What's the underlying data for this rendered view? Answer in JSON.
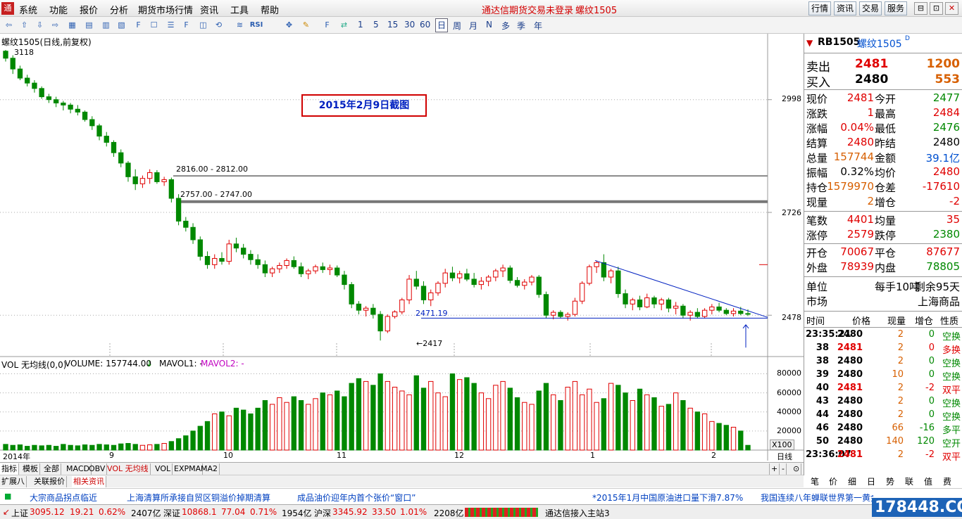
{
  "menu": {
    "logo": "通",
    "items": [
      "系统",
      "功能",
      "报价",
      "分析",
      "期货市场行情",
      "资讯",
      "工具",
      "帮助"
    ],
    "status": "通达信期货交易未登录",
    "symbol": "螺纹1505",
    "buttons": [
      "行情",
      "资讯",
      "交易",
      "服务"
    ],
    "win": [
      "⊟",
      "⊡",
      "✕"
    ]
  },
  "toolbar": {
    "periods": [
      "1",
      "5",
      "15",
      "30",
      "60",
      "日",
      "周",
      "月",
      "年",
      "多",
      "季",
      "年"
    ]
  },
  "chart": {
    "title": "螺纹1505(日线,前复权)",
    "high_label": "3118",
    "low_label": "←2417",
    "annotation": "2015年2月9日截图",
    "zone1": "2816.00 - 2812.00",
    "zone2": "2757.00 - 2747.00",
    "support_label": "2471.19",
    "price_axis": [
      "2998",
      "2726",
      "2478"
    ],
    "vol_axis": [
      "80000",
      "60000",
      "40000",
      "20000",
      "X100"
    ],
    "dates": [
      "2014年",
      "9",
      "10",
      "11",
      "12",
      "1",
      "2"
    ],
    "vol_caption": {
      "a": "VOL 无均线(0,0)",
      "b": "VOLUME: 157744.00",
      "c": "MAVOL1: -",
      "d": "MAVOL2: -",
      "arrow": "↓"
    },
    "daily_tab": "日线"
  },
  "chart_data": {
    "type": "candlestick",
    "title": "螺纹1505(日线,前复权)",
    "ylim": [
      2380,
      3140
    ],
    "note": "daily bars Aug 2014 – Feb 2015",
    "ohlc": [
      [
        3115,
        3118,
        3090,
        3098
      ],
      [
        3098,
        3105,
        3060,
        3072
      ],
      [
        3072,
        3080,
        3045,
        3050
      ],
      [
        3050,
        3058,
        3030,
        3038
      ],
      [
        3038,
        3045,
        3015,
        3025
      ],
      [
        3025,
        3030,
        3000,
        3005
      ],
      [
        3005,
        3012,
        2990,
        2998
      ],
      [
        2998,
        3005,
        2980,
        2990
      ],
      [
        2990,
        2995,
        2972,
        2985
      ],
      [
        2985,
        2990,
        2965,
        2975
      ],
      [
        2975,
        2985,
        2960,
        2968
      ],
      [
        2968,
        2972,
        2945,
        2950
      ],
      [
        2950,
        2958,
        2925,
        2935
      ],
      [
        2935,
        2940,
        2900,
        2910
      ],
      [
        2910,
        2920,
        2885,
        2895
      ],
      [
        2895,
        2900,
        2860,
        2870
      ],
      [
        2870,
        2878,
        2835,
        2845
      ],
      [
        2845,
        2850,
        2800,
        2812
      ],
      [
        2812,
        2830,
        2780,
        2795
      ],
      [
        2795,
        2815,
        2785,
        2808
      ],
      [
        2808,
        2830,
        2795,
        2822
      ],
      [
        2822,
        2828,
        2795,
        2800
      ],
      [
        2800,
        2812,
        2790,
        2805
      ],
      [
        2805,
        2810,
        2750,
        2760
      ],
      [
        2760,
        2770,
        2695,
        2705
      ],
      [
        2705,
        2715,
        2680,
        2690
      ],
      [
        2690,
        2700,
        2650,
        2660
      ],
      [
        2660,
        2668,
        2610,
        2620
      ],
      [
        2620,
        2632,
        2590,
        2600
      ],
      [
        2600,
        2625,
        2590,
        2615
      ],
      [
        2615,
        2630,
        2600,
        2608
      ],
      [
        2608,
        2660,
        2600,
        2650
      ],
      [
        2650,
        2665,
        2630,
        2640
      ],
      [
        2640,
        2650,
        2615,
        2625
      ],
      [
        2625,
        2635,
        2600,
        2612
      ],
      [
        2612,
        2625,
        2590,
        2600
      ],
      [
        2600,
        2610,
        2570,
        2580
      ],
      [
        2580,
        2595,
        2570,
        2590
      ],
      [
        2590,
        2605,
        2580,
        2598
      ],
      [
        2598,
        2615,
        2590,
        2610
      ],
      [
        2610,
        2620,
        2590,
        2595
      ],
      [
        2595,
        2605,
        2570,
        2578
      ],
      [
        2578,
        2590,
        2565,
        2585
      ],
      [
        2585,
        2600,
        2578,
        2595
      ],
      [
        2595,
        2605,
        2580,
        2588
      ],
      [
        2588,
        2600,
        2575,
        2592
      ],
      [
        2592,
        2598,
        2570,
        2575
      ],
      [
        2575,
        2585,
        2540,
        2552
      ],
      [
        2552,
        2558,
        2495,
        2505
      ],
      [
        2505,
        2512,
        2480,
        2490
      ],
      [
        2490,
        2500,
        2475,
        2495
      ],
      [
        2495,
        2505,
        2470,
        2480
      ],
      [
        2480,
        2488,
        2417,
        2440
      ],
      [
        2440,
        2480,
        2435,
        2475
      ],
      [
        2475,
        2490,
        2470,
        2486
      ],
      [
        2486,
        2520,
        2480,
        2515
      ],
      [
        2515,
        2575,
        2505,
        2565
      ],
      [
        2565,
        2585,
        2540,
        2548
      ],
      [
        2548,
        2560,
        2505,
        2515
      ],
      [
        2515,
        2540,
        2500,
        2532
      ],
      [
        2532,
        2560,
        2525,
        2555
      ],
      [
        2555,
        2590,
        2545,
        2580
      ],
      [
        2580,
        2595,
        2560,
        2568
      ],
      [
        2568,
        2585,
        2555,
        2578
      ],
      [
        2578,
        2590,
        2560,
        2565
      ],
      [
        2565,
        2580,
        2545,
        2552
      ],
      [
        2552,
        2570,
        2540,
        2560
      ],
      [
        2560,
        2575,
        2548,
        2570
      ],
      [
        2570,
        2590,
        2560,
        2585
      ],
      [
        2585,
        2600,
        2570,
        2592
      ],
      [
        2592,
        2598,
        2555,
        2562
      ],
      [
        2562,
        2570,
        2545,
        2550
      ],
      [
        2550,
        2565,
        2540,
        2558
      ],
      [
        2558,
        2575,
        2550,
        2570
      ],
      [
        2570,
        2575,
        2520,
        2528
      ],
      [
        2528,
        2535,
        2470,
        2478
      ],
      [
        2478,
        2490,
        2468,
        2485
      ],
      [
        2485,
        2490,
        2470,
        2475
      ],
      [
        2475,
        2485,
        2465,
        2480
      ],
      [
        2480,
        2520,
        2475,
        2512
      ],
      [
        2512,
        2560,
        2505,
        2555
      ],
      [
        2555,
        2600,
        2550,
        2595
      ],
      [
        2595,
        2610,
        2580,
        2605
      ],
      [
        2605,
        2625,
        2560,
        2570
      ],
      [
        2570,
        2590,
        2555,
        2585
      ],
      [
        2585,
        2595,
        2520,
        2530
      ],
      [
        2530,
        2540,
        2495,
        2505
      ],
      [
        2505,
        2520,
        2490,
        2515
      ],
      [
        2515,
        2525,
        2490,
        2498
      ],
      [
        2498,
        2530,
        2495,
        2520
      ],
      [
        2520,
        2525,
        2495,
        2505
      ],
      [
        2505,
        2520,
        2490,
        2515
      ],
      [
        2515,
        2520,
        2485,
        2495
      ],
      [
        2495,
        2510,
        2480,
        2500
      ],
      [
        2500,
        2505,
        2470,
        2478
      ],
      [
        2478,
        2490,
        2465,
        2485
      ],
      [
        2485,
        2495,
        2470,
        2475
      ],
      [
        2475,
        2495,
        2470,
        2490
      ],
      [
        2490,
        2505,
        2480,
        2498
      ],
      [
        2498,
        2508,
        2485,
        2490
      ],
      [
        2490,
        2495,
        2478,
        2482
      ],
      [
        2482,
        2495,
        2475,
        2488
      ],
      [
        2488,
        2498,
        2478,
        2482
      ],
      [
        2482,
        2492,
        2476,
        2481
      ]
    ],
    "volume": [
      6000,
      5000,
      5500,
      4000,
      5000,
      4500,
      5000,
      4000,
      6000,
      5000,
      4500,
      5500,
      5000,
      6000,
      5500,
      5000,
      6500,
      7000,
      6000,
      5000,
      5500,
      6000,
      7000,
      9000,
      12000,
      15000,
      20000,
      25000,
      30000,
      38000,
      40000,
      36000,
      44000,
      42000,
      38000,
      44000,
      52000,
      48000,
      55000,
      50000,
      56000,
      52000,
      48000,
      54000,
      60000,
      58000,
      62000,
      56000,
      70000,
      75000,
      72000,
      68000,
      80000,
      72000,
      66000,
      62000,
      58000,
      78000,
      65000,
      72000,
      60000,
      56000,
      80000,
      74000,
      76000,
      70000,
      60000,
      54000,
      68000,
      72000,
      65000,
      55000,
      50000,
      48000,
      62000,
      70000,
      58000,
      52000,
      66000,
      72000,
      58000,
      64000,
      50000,
      54000,
      70000,
      68000,
      60000,
      52000,
      64000,
      58000,
      55000,
      46000,
      48000,
      60000,
      52000,
      44000,
      40000,
      38000,
      30000,
      28000,
      26000,
      24000,
      20000,
      5000
    ]
  },
  "quote": {
    "code": "RB1505",
    "name": "螺纹1505",
    "tag": "D",
    "ask_label": "卖出",
    "ask": "2481",
    "ask_vol": "1200",
    "bid_label": "买入",
    "bid": "2480",
    "bid_vol": "553",
    "rows": [
      {
        "l1": "现价",
        "v1": "2481",
        "c1": "red",
        "l2": "今开",
        "v2": "2477",
        "c2": "green"
      },
      {
        "l1": "涨跌",
        "v1": "1",
        "c1": "red",
        "l2": "最高",
        "v2": "2484",
        "c2": "red"
      },
      {
        "l1": "涨幅",
        "v1": "0.04%",
        "c1": "red",
        "l2": "最低",
        "v2": "2476",
        "c2": "green"
      },
      {
        "l1": "结算",
        "v1": "2480",
        "c1": "red",
        "l2": "昨结",
        "v2": "2480",
        "c2": "black"
      },
      {
        "l1": "总量",
        "v1": "157744",
        "c1": "orange",
        "l2": "金额",
        "v2": "39.1亿",
        "c2": "blue"
      },
      {
        "l1": "振幅",
        "v1": "0.32%",
        "c1": "black",
        "l2": "均价",
        "v2": "2480",
        "c2": "red"
      },
      {
        "l1": "持仓",
        "v1": "1579970",
        "c1": "orange",
        "l2": "仓差",
        "v2": "-17610",
        "c2": "red"
      },
      {
        "l1": "现量",
        "v1": "2",
        "c1": "orange",
        "l2": "增仓",
        "v2": "-2",
        "c2": "red"
      }
    ],
    "rows2": [
      {
        "l1": "笔数",
        "v1": "4401",
        "c1": "red",
        "l2": "均量",
        "v2": "35",
        "c2": "red"
      },
      {
        "l1": "涨停",
        "v1": "2579",
        "c1": "red",
        "l2": "跌停",
        "v2": "2380",
        "c2": "green"
      }
    ],
    "rows3": [
      {
        "l1": "开仓",
        "v1": "70067",
        "c1": "red",
        "l2": "平仓",
        "v2": "87677",
        "c2": "red"
      },
      {
        "l1": "外盘",
        "v1": "78939",
        "c1": "red",
        "l2": "内盘",
        "v2": "78805",
        "c2": "green"
      }
    ],
    "unit_label": "单位",
    "unit_val": "每手10吨",
    "remain": "剩余95天",
    "market_label": "市场",
    "market_val": "上海商品"
  },
  "ticks": {
    "header": [
      "时间",
      "价格",
      "现量",
      "增仓",
      "性质"
    ],
    "rows": [
      {
        "t": "23:35:21",
        "p": "2480",
        "pc": "black",
        "v": "2",
        "z": "0",
        "zc": "green",
        "k": "空换",
        "kc": "green"
      },
      {
        "t": "38",
        "p": "2481",
        "pc": "red",
        "v": "2",
        "z": "0",
        "zc": "red",
        "k": "多换",
        "kc": "red"
      },
      {
        "t": "38",
        "p": "2480",
        "pc": "black",
        "v": "2",
        "z": "0",
        "zc": "green",
        "k": "空换",
        "kc": "green"
      },
      {
        "t": "39",
        "p": "2480",
        "pc": "black",
        "v": "10",
        "z": "0",
        "zc": "green",
        "k": "空换",
        "kc": "green"
      },
      {
        "t": "40",
        "p": "2481",
        "pc": "red",
        "v": "2",
        "z": "-2",
        "zc": "red",
        "k": "双平",
        "kc": "red"
      },
      {
        "t": "43",
        "p": "2480",
        "pc": "black",
        "v": "2",
        "z": "0",
        "zc": "green",
        "k": "空换",
        "kc": "green"
      },
      {
        "t": "44",
        "p": "2480",
        "pc": "black",
        "v": "2",
        "z": "0",
        "zc": "green",
        "k": "空换",
        "kc": "green"
      },
      {
        "t": "46",
        "p": "2480",
        "pc": "black",
        "v": "66",
        "z": "-16",
        "zc": "green",
        "k": "多平",
        "kc": "green"
      },
      {
        "t": "50",
        "p": "2480",
        "pc": "black",
        "v": "140",
        "z": "120",
        "zc": "green",
        "k": "空开",
        "kc": "green"
      },
      {
        "t": "23:36:07",
        "p": "2481",
        "pc": "red",
        "v": "2",
        "z": "-2",
        "zc": "red",
        "k": "双平",
        "kc": "red"
      }
    ]
  },
  "bottom_tabs": [
    "指标",
    "模板",
    "全部",
    "MACD",
    "OBV",
    "VOL 无均线",
    "VOL",
    "EXPMA",
    "MA2"
  ],
  "bottom_tabs2": [
    "扩展八",
    "关联报价",
    "相关资讯"
  ],
  "side_tabs": [
    "笔",
    "价",
    "细",
    "日",
    "势",
    "联",
    "值",
    "费"
  ],
  "news": [
    "大宗商品拐点临近",
    "上海清算所承接自贸区铜溢价掉期清算",
    "成品油价迎年内首个张价“窗口”",
    "*2015年1月中国原油进口量下滑7.87%",
    "我国连续八年蝉联世界第一黄金"
  ],
  "ticker": {
    "sh_label": "上证",
    "sh": "3095.12",
    "sh_ch": "19.21",
    "sh_pct": "0.62%",
    "sh_amt": "2407亿",
    "sz_label": "深证",
    "sz": "10868.1",
    "sz_ch": "77.04",
    "sz_pct": "0.71%",
    "sz_amt": "1954亿",
    "hs_label": "沪深",
    "hs": "3345.92",
    "hs_ch": "33.50",
    "hs_pct": "1.01%",
    "hs_amt": "2208亿",
    "conn": "通达信接入主站3",
    "watermark": "178448.COM"
  }
}
